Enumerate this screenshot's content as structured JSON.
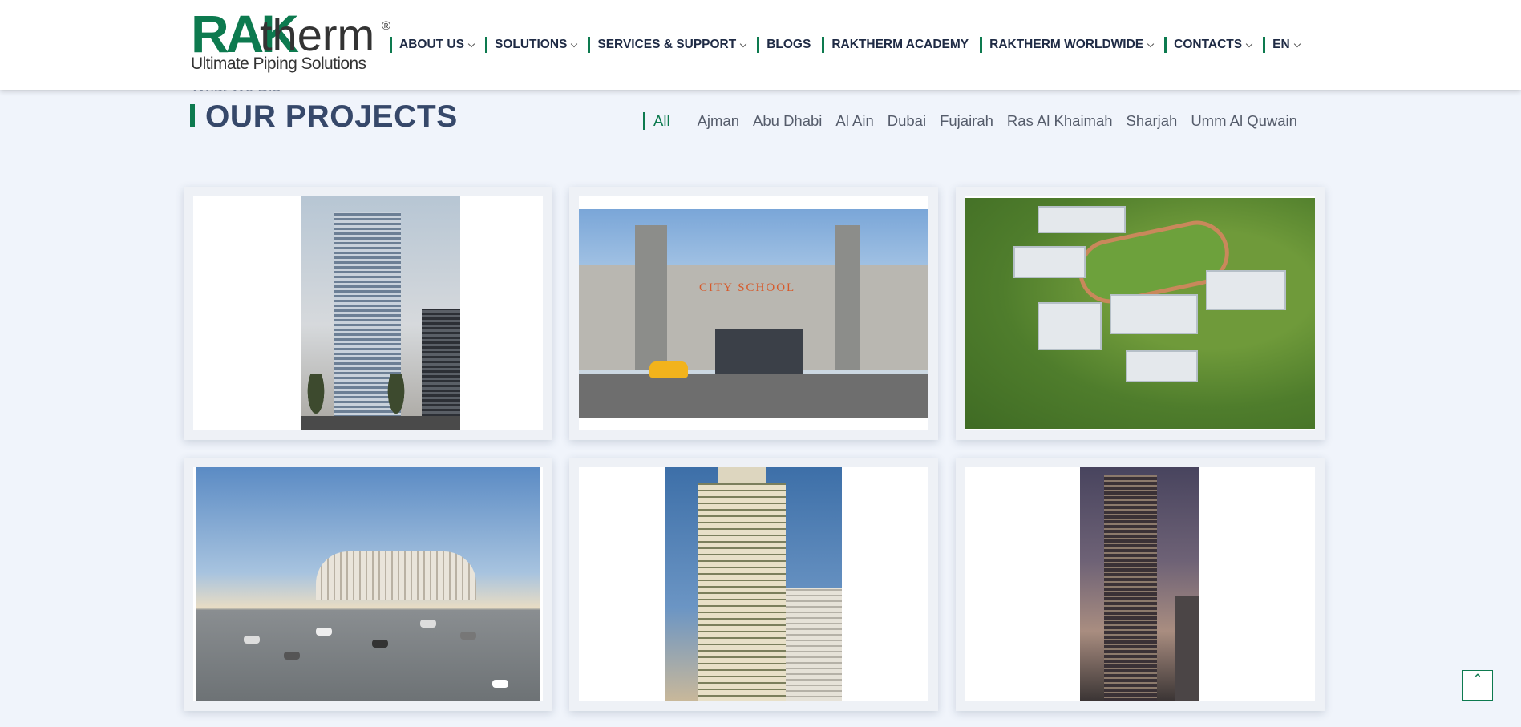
{
  "brand": {
    "logo_mark": "RAK",
    "logo_word": "therm",
    "logo_reg": "®",
    "tagline": "Ultimate Piping Solutions"
  },
  "nav": {
    "items": [
      {
        "label": "ABOUT US",
        "dropdown": true
      },
      {
        "label": "SOLUTIONS",
        "dropdown": true
      },
      {
        "label": "SERVICES & SUPPORT",
        "dropdown": true
      },
      {
        "label": "BLOGS",
        "dropdown": false
      },
      {
        "label": "RAKTHERM ACADEMY",
        "dropdown": false
      },
      {
        "label": "RAKTHERM WORLDWIDE",
        "dropdown": true
      },
      {
        "label": "CONTACTS",
        "dropdown": true
      },
      {
        "label": "EN",
        "dropdown": true
      }
    ]
  },
  "section": {
    "eyebrow": "What We Did",
    "title": "OUR PROJECTS"
  },
  "filters": {
    "active": "All",
    "items": [
      "All",
      "Ajman",
      "Abu Dhabi",
      "Al Ain",
      "Dubai",
      "Fujairah",
      "Ras Al Khaimah",
      "Sharjah",
      "Umm Al Quwain"
    ]
  },
  "projects": [
    {
      "image": "tower-photo"
    },
    {
      "image": "school-photo",
      "sign_text": "CITY SCHOOL"
    },
    {
      "image": "campus-aerial-photo"
    },
    {
      "image": "mall-rendering"
    },
    {
      "image": "cream-tower-photo"
    },
    {
      "image": "dusk-tower-rendering"
    }
  ],
  "colors": {
    "accent": "#0d7a4f",
    "heading": "#36486a",
    "background": "#f0f4fb"
  },
  "back_to_top": {
    "icon": "double-chevron-up-icon",
    "glyph": "⌃"
  }
}
